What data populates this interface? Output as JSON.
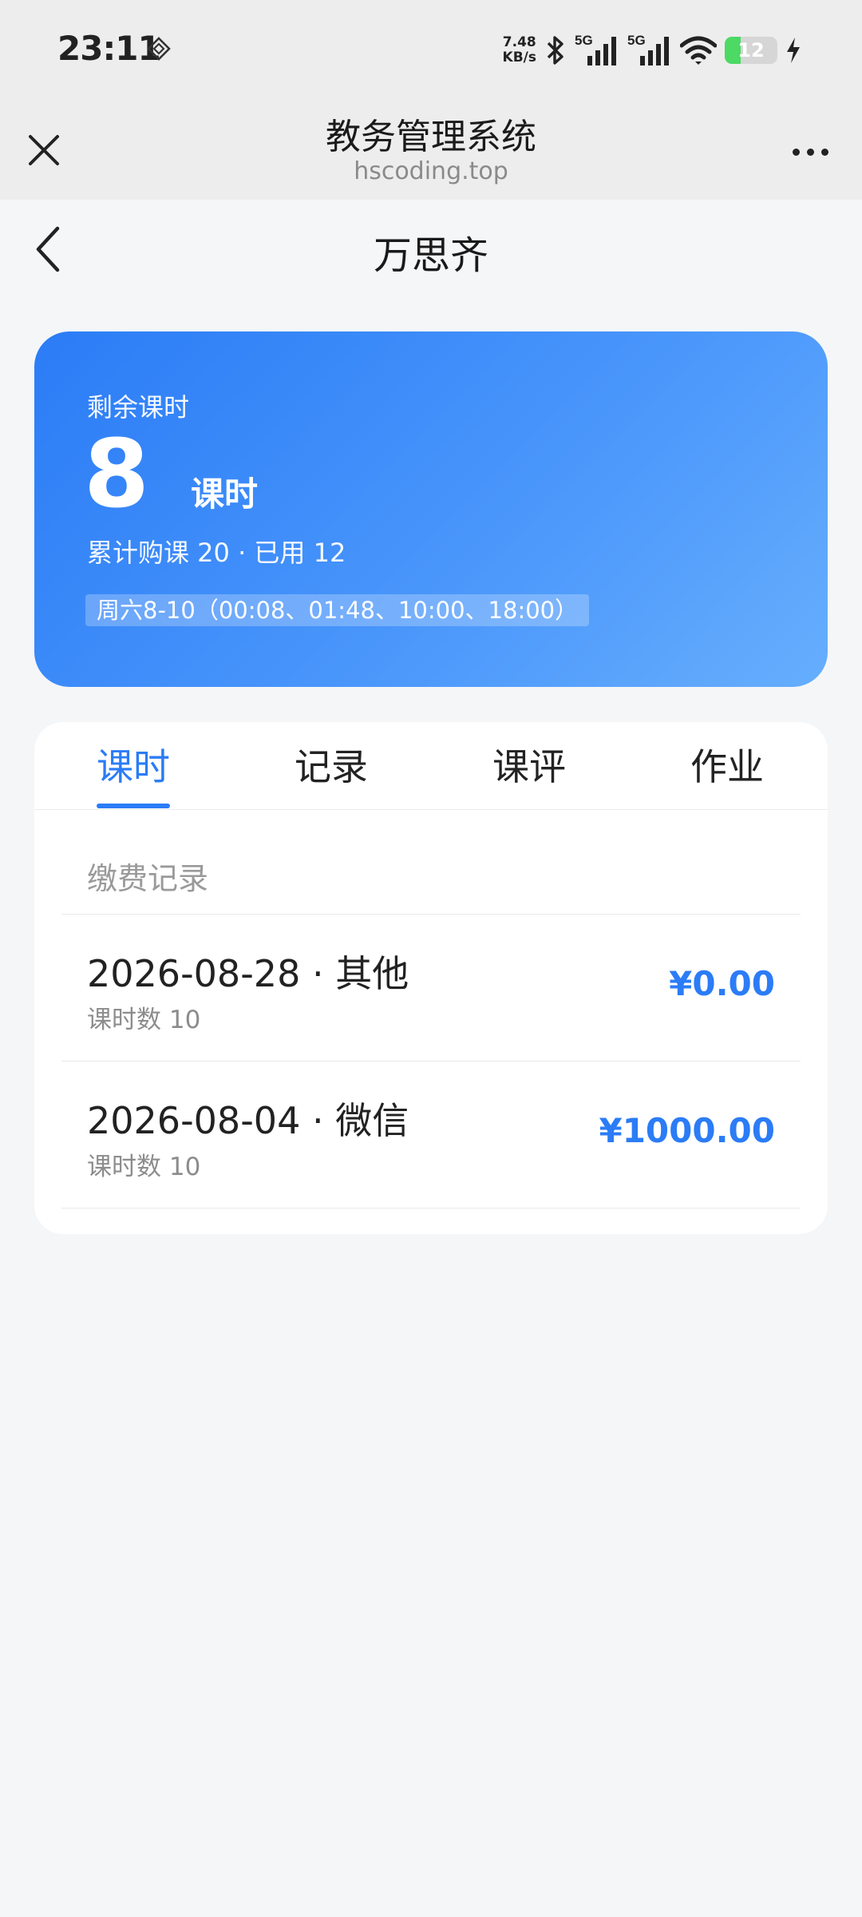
{
  "status_bar": {
    "time": "23:11",
    "net_speed_value": "7.48",
    "net_speed_unit": "KB/s",
    "signal1_label": "5G",
    "signal2_label": "5G",
    "battery_level": "12",
    "icons": [
      "diamond-icon",
      "bluetooth-icon",
      "signal-icon",
      "wifi-icon",
      "battery-icon",
      "charging-icon"
    ]
  },
  "browser": {
    "title": "教务管理系统",
    "url": "hscoding.top",
    "icons": [
      "close-icon",
      "more-icon"
    ]
  },
  "page": {
    "title": "万思齐"
  },
  "hero": {
    "label": "剩余课时",
    "remaining": "8",
    "unit": "课时",
    "summary": "累计购课 20 · 已用 12",
    "schedule": "周六8-10（00:08、01:48、10:00、18:00）"
  },
  "tabs": [
    {
      "label": "课时",
      "active": true
    },
    {
      "label": "记录",
      "active": false
    },
    {
      "label": "课评",
      "active": false
    },
    {
      "label": "作业",
      "active": false
    }
  ],
  "payments": {
    "heading": "缴费记录",
    "records": [
      {
        "title": "2026-08-28 · 其他",
        "sub": "课时数 10",
        "amount": "¥0.00"
      },
      {
        "title": "2026-08-04 · 微信",
        "sub": "课时数 10",
        "amount": "¥1000.00"
      }
    ]
  },
  "colors": {
    "accent": "#2b7cf6",
    "hero_gradient_start": "#2b7cf6",
    "hero_gradient_end": "#66aefd",
    "page_bg": "#f5f6f8",
    "battery_green": "#4cd964"
  }
}
